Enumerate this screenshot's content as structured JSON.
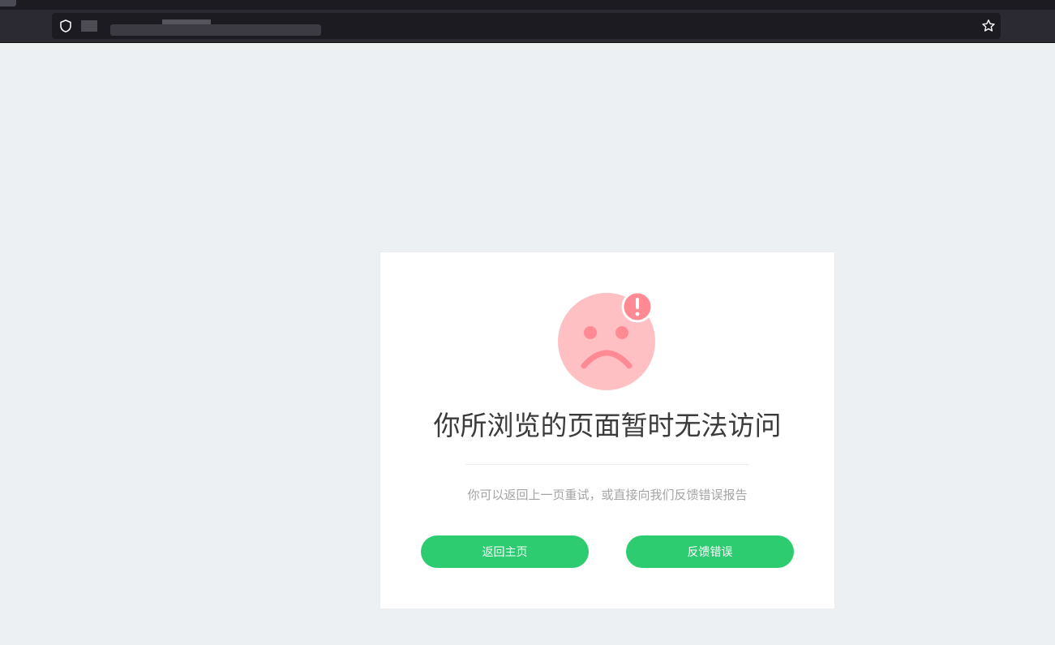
{
  "browser": {
    "url": "",
    "icons": {
      "site_info": "shield-icon",
      "bookmark": "star-icon"
    }
  },
  "error_card": {
    "illustration": "sad-face-alert-icon",
    "title": "你所浏览的页面暂时无法访问",
    "message": "你可以返回上一页重试，或直接向我们反馈错误报告",
    "buttons": {
      "home_label": "返回主页",
      "feedback_label": "反馈错误"
    }
  },
  "colors": {
    "page_background": "#edf0f3",
    "card_background": "#ffffff",
    "button_green": "#2ecc71",
    "face_pink": "#ffc0c4",
    "face_features": "#ff8a94",
    "title_text": "#3b3b3b",
    "message_text": "#a4a4a4"
  }
}
